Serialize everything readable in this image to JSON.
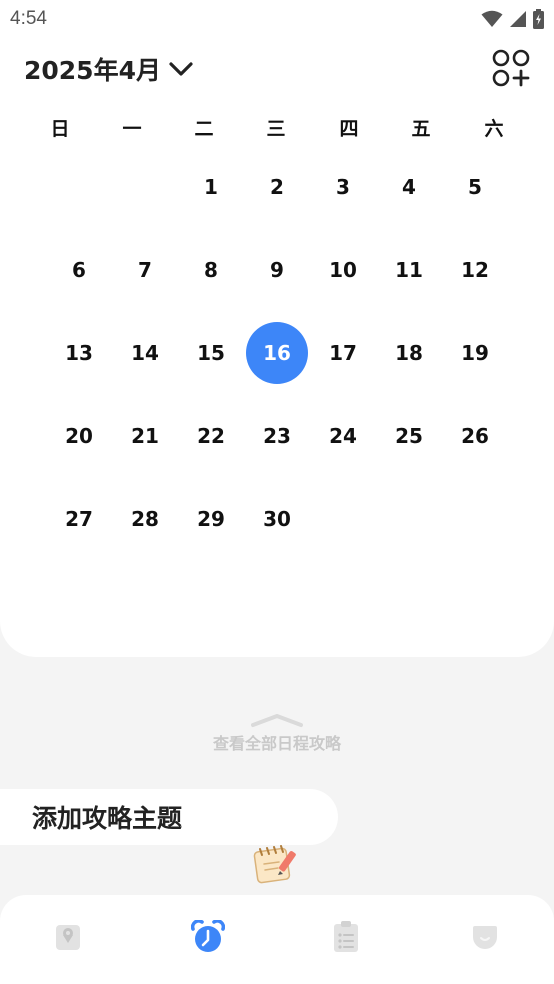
{
  "status_bar": {
    "time": "4:54"
  },
  "header": {
    "month_label": "2025年4月"
  },
  "weekdays": [
    "日",
    "一",
    "二",
    "三",
    "四",
    "五",
    "六"
  ],
  "calendar": {
    "year": 2025,
    "month": 4,
    "selected_day": 16,
    "weeks": [
      [
        "",
        "",
        "1",
        "2",
        "3",
        "4",
        "5"
      ],
      [
        "6",
        "7",
        "8",
        "9",
        "10",
        "11",
        "12"
      ],
      [
        "13",
        "14",
        "15",
        "16",
        "17",
        "18",
        "19"
      ],
      [
        "20",
        "21",
        "22",
        "23",
        "24",
        "25",
        "26"
      ],
      [
        "27",
        "28",
        "29",
        "30",
        "",
        "",
        ""
      ]
    ]
  },
  "view_all": {
    "label": "查看全部日程攻略"
  },
  "add_theme": {
    "label": "添加攻略主题"
  },
  "bottom_nav": {
    "items": [
      {
        "icon": "map-pin-icon",
        "active": false
      },
      {
        "icon": "alarm-clock-icon",
        "active": true
      },
      {
        "icon": "checklist-icon",
        "active": false
      },
      {
        "icon": "face-icon",
        "active": false
      }
    ]
  },
  "colors": {
    "accent": "#3d86f8",
    "background": "#f4f4f4",
    "card": "#ffffff",
    "inactive_icon": "#e2e2e2",
    "muted_text": "#c9c9c9"
  }
}
